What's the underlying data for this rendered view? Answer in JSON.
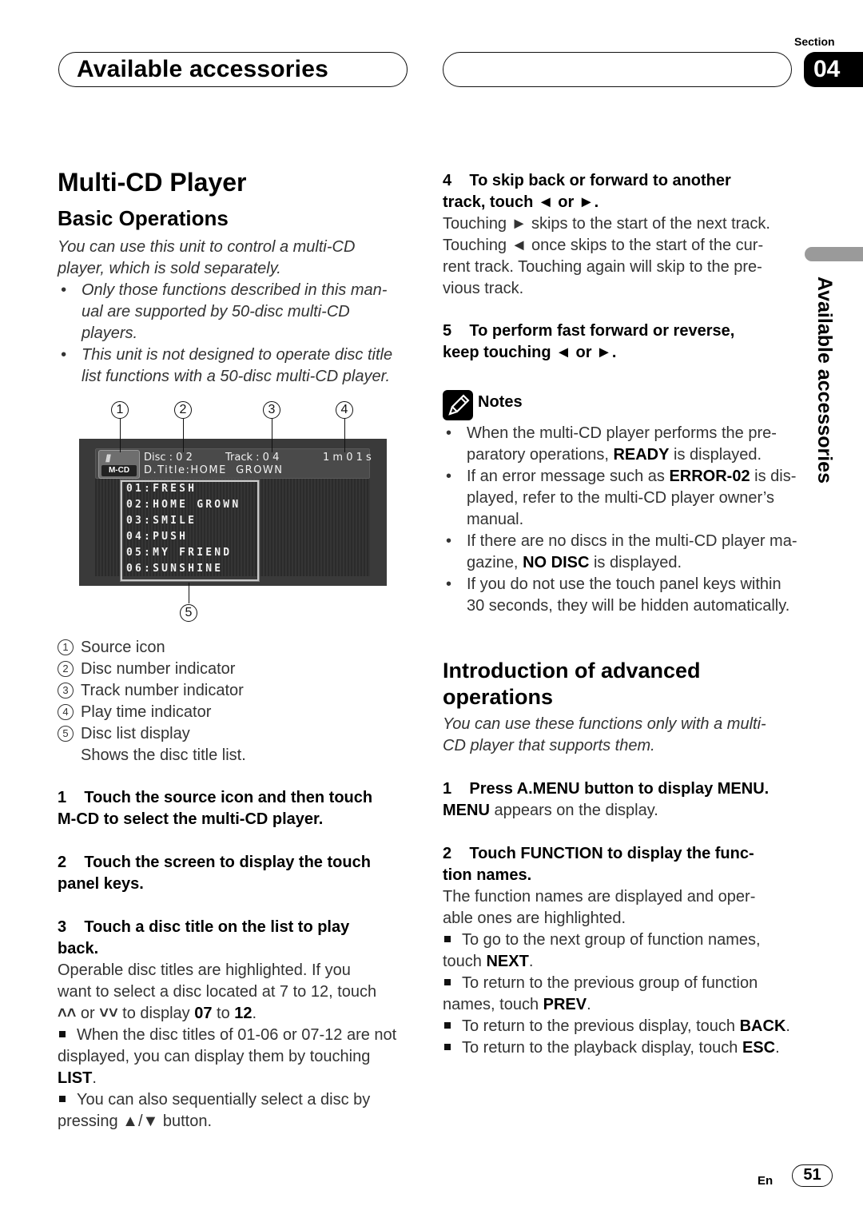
{
  "header": {
    "section_title": "Available accessories",
    "section_label": "Section",
    "section_number": "04"
  },
  "side_tab": {
    "label": "Available accessories"
  },
  "left": {
    "page_title": "Multi-CD Player",
    "subtitle": "Basic Operations",
    "intro_line1": "You can use this unit to control a multi-CD",
    "intro_line2": "player, which is sold separately.",
    "bullets": [
      [
        "Only those functions described in this man-",
        "ual are supported by 50-disc multi-CD",
        "players."
      ],
      [
        "This unit is not designed to operate disc title",
        "list functions with a 50-disc multi-CD player."
      ]
    ],
    "figure": {
      "callouts": [
        "1",
        "2",
        "3",
        "4",
        "5"
      ],
      "source_icon_label": "M-CD",
      "disc_label": "Disc : 0 2",
      "track_label": "Track : 0 4",
      "play_time": "1 m 0 1 s",
      "disc_title": "D.Title:HOME  GROWN",
      "disc_list": [
        "01:FRESH",
        "02:HOME GROWN",
        "03:SMILE",
        "04:PUSH",
        "05:MY FRIEND",
        "06:SUNSHINE"
      ]
    },
    "legend": [
      {
        "num": "1",
        "label": "Source icon"
      },
      {
        "num": "2",
        "label": "Disc number indicator"
      },
      {
        "num": "3",
        "label": "Track number indicator"
      },
      {
        "num": "4",
        "label": "Play time indicator"
      },
      {
        "num": "5",
        "label": "Disc list display"
      }
    ],
    "legend_note": "Shows the disc title list.",
    "steps": {
      "s1_line1": "1    Touch the source icon and then touch",
      "s1_line2": "M-CD to select the multi-CD player.",
      "s2_line1": "2    Touch the screen to display the touch",
      "s2_line2": "panel keys.",
      "s3_line1": "3    Touch a disc title on the list to play",
      "s3_line2": "back.",
      "s3_body1": "Operable disc titles are highlighted. If you",
      "s3_body2": "want to select a disc located at 7 to 12, touch",
      "s3_body3_or": " or ",
      "s3_body3_mid": " to display ",
      "s3_body3_b1": "07",
      "s3_body3_to": " to ",
      "s3_body3_b2": "12",
      "s3_body3_end": ".",
      "note1_line1": "When the disc titles of 01-06 or 07-12 are not",
      "note1_line2": "displayed, you can display them by touching",
      "note1_key": "LIST",
      "note2_line1": "You can also sequentially select a disc by",
      "note2_line2": "pressing ▲/▼ button."
    }
  },
  "right": {
    "s4_line1": "4    To skip back or forward to another",
    "s4_line2": "track, touch ◄ or ►.",
    "s4_body": [
      "Touching ► skips to the start of the next track.",
      "Touching ◄ once skips to the start of the cur-",
      "rent track. Touching again will skip to the pre-",
      "vious track."
    ],
    "s5_line1": "5    To perform fast forward or reverse,",
    "s5_line2": "keep touching ◄ or ►.",
    "notes_label": "Notes",
    "notes": {
      "n1a": "When the multi-CD player performs the pre-",
      "n1b_pre": "paratory operations, ",
      "n1b_key": "READY",
      "n1b_post": " is displayed.",
      "n2a_pre": "If an error message such as ",
      "n2a_key": "ERROR-02",
      "n2a_post": " is dis-",
      "n2b": "played, refer to the multi-CD player owner’s",
      "n2c": "manual.",
      "n3a": "If there are no discs in the multi-CD player ma-",
      "n3b_pre": "gazine, ",
      "n3b_key": "NO DISC",
      "n3b_post": " is displayed.",
      "n4a": "If you do not use the touch panel keys within",
      "n4b": "30 seconds, they will be hidden automatically."
    },
    "adv_title": "Introduction of advanced operations",
    "adv_intro1": "You can use these functions only with a multi-",
    "adv_intro2": "CD player that supports them.",
    "a1_line1": "1    Press A.MENU button to display MENU.",
    "a1_key": "MENU",
    "a1_body": " appears on the display.",
    "a2_line1": "2    Touch FUNCTION to display the func-",
    "a2_line2": "tion names.",
    "a2_body1": "The function names are displayed and oper-",
    "a2_body2": "able ones are highlighted.",
    "tips": {
      "t1a": "To go to the next group of function names,",
      "t1b_pre": "touch ",
      "t1b_key": "NEXT",
      "t2a": "To return to the previous group of function",
      "t2b_pre": "names, touch ",
      "t2b_key": "PREV",
      "t3_pre": "To return to the previous display, touch ",
      "t3_key": "BACK",
      "t4_pre": "To return to the playback display, touch ",
      "t4_key": "ESC"
    }
  },
  "footer": {
    "lang": "En",
    "page_number": "51"
  }
}
